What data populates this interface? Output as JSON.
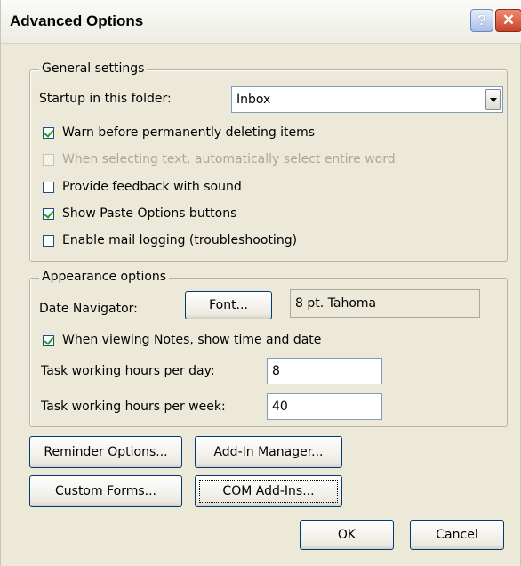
{
  "window": {
    "title": "Advanced Options",
    "help_label": "?",
    "close_label": "✕"
  },
  "general": {
    "legend": "General settings",
    "startup_label": "Startup in this folder:",
    "startup_value": "Inbox",
    "options": [
      {
        "label": "Warn before permanently deleting items",
        "checked": true,
        "enabled": true
      },
      {
        "label": "When selecting text, automatically select entire word",
        "checked": false,
        "enabled": false
      },
      {
        "label": "Provide feedback with sound",
        "checked": false,
        "enabled": true
      },
      {
        "label": "Show Paste Options buttons",
        "checked": true,
        "enabled": true
      },
      {
        "label": "Enable mail logging (troubleshooting)",
        "checked": false,
        "enabled": true
      }
    ]
  },
  "appearance": {
    "legend": "Appearance options",
    "date_nav_label": "Date Navigator:",
    "font_button": "Font...",
    "font_value": "8 pt. Tahoma",
    "notes_option": {
      "label": "When viewing Notes, show time and date",
      "checked": true
    },
    "hours_day_label": "Task working hours per day:",
    "hours_day_value": "8",
    "hours_week_label": "Task working hours per week:",
    "hours_week_value": "40"
  },
  "buttons": {
    "reminder": "Reminder Options...",
    "addin_manager": "Add-In Manager...",
    "custom_forms": "Custom Forms...",
    "com_addins": "COM Add-Ins...",
    "ok": "OK",
    "cancel": "Cancel"
  }
}
